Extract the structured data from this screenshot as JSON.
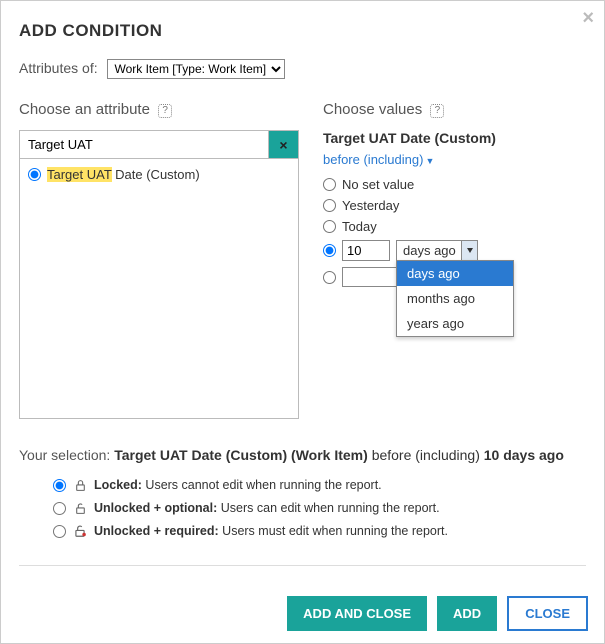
{
  "dialog": {
    "title": "ADD CONDITION",
    "close_x": "×"
  },
  "attributes": {
    "label": "Attributes of:",
    "selected": "Work Item [Type: Work Item]"
  },
  "left": {
    "heading": "Choose an attribute",
    "search_value": "Target UAT",
    "clear_glyph": "×",
    "results": [
      {
        "highlight": "Target UAT",
        "rest": " Date (Custom)",
        "selected": true
      }
    ]
  },
  "right": {
    "heading": "Choose values",
    "attr_title": "Target UAT Date (Custom)",
    "operator_label": "before (including)",
    "options": {
      "no_set": "No set value",
      "yesterday": "Yesterday",
      "today": "Today",
      "custom_number": "10",
      "unit_selected": "days ago",
      "unit_options": [
        "days ago",
        "months ago",
        "years ago"
      ]
    }
  },
  "selection": {
    "lead": "Your selection: ",
    "attr": "Target UAT Date (Custom) (Work Item)",
    "mid": " before (including) ",
    "value": "10 days ago"
  },
  "locks": {
    "locked_label": "Locked:",
    "locked_desc": " Users cannot edit when running the report.",
    "unlocked_opt_label": "Unlocked + optional:",
    "unlocked_opt_desc": " Users can edit when running the report.",
    "unlocked_req_label": "Unlocked + required:",
    "unlocked_req_desc": " Users must edit when running the report."
  },
  "footer": {
    "add_close": "ADD AND CLOSE",
    "add": "ADD",
    "close": "CLOSE"
  },
  "help_glyph": "?"
}
